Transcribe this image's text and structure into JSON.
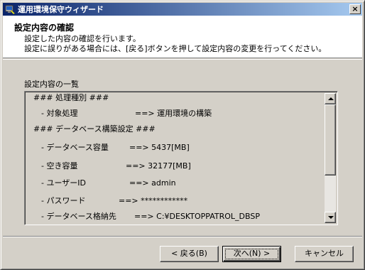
{
  "window": {
    "title": "運用環境保守ウィザード",
    "close_label": "×"
  },
  "header": {
    "title": "設定内容の確認",
    "line1": "設定した内容の確認を行います。",
    "line2": "設定に誤りがある場合には、[戻る]ボタンを押して設定内容の変更を行ってください。"
  },
  "list": {
    "label": "設定内容の一覧",
    "rows": [
      {
        "key": "### 処理種別 ###",
        "value": ""
      },
      {
        "key": "　- 対象処理",
        "value": "==> 運用環境の構築"
      },
      {
        "key": "### データベース構築設定 ###",
        "value": ""
      },
      {
        "key": "　- データベース容量",
        "value": "==> 5437[MB]"
      },
      {
        "key": "　- 空き容量",
        "value": "==> 32177[MB]"
      },
      {
        "key": "　- ユーザーID",
        "value": "==> admin"
      },
      {
        "key": "　- パスワード",
        "value": "==> ************"
      },
      {
        "key": "　- データベース格納先",
        "value": "==> C:¥DESKTOPPATROL_DBSP"
      }
    ]
  },
  "buttons": {
    "back": "< 戻る(B)",
    "next": "次へ(N) >",
    "cancel": "キャンセル"
  },
  "colors": {
    "title_gradient_start": "#0a246a",
    "title_gradient_end": "#a6caf0",
    "face": "#d4d0c8"
  }
}
